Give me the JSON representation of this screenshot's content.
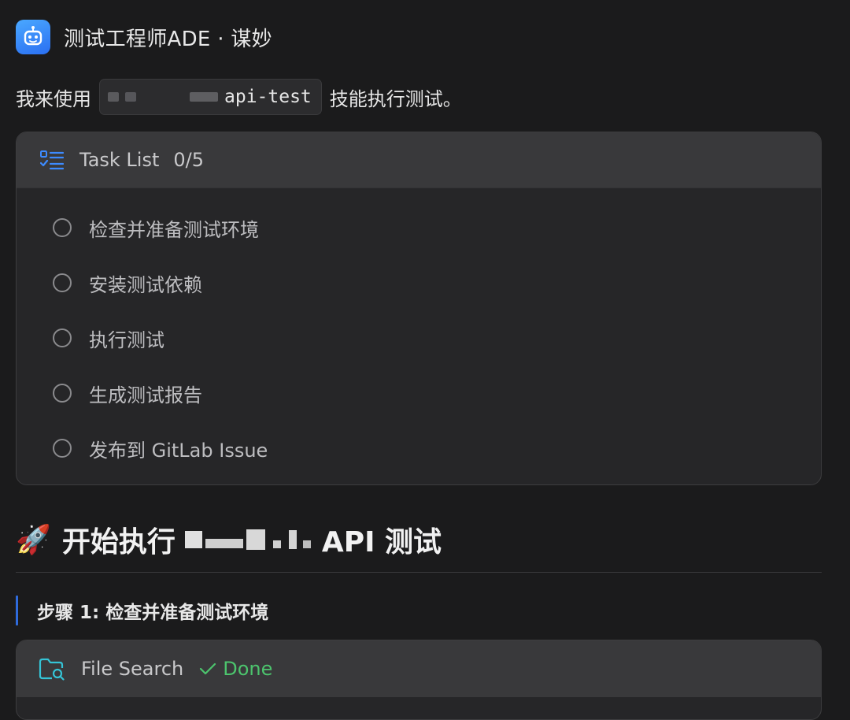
{
  "header": {
    "title": "测试工程师ADE · 谋妙"
  },
  "intro": {
    "prefix": "我来使用",
    "code": "api-test",
    "suffix": "技能执行测试。"
  },
  "task_list": {
    "title": "Task List",
    "count": "0/5",
    "items": [
      {
        "label": "检查并准备测试环境"
      },
      {
        "label": "安装测试依赖"
      },
      {
        "label": "执行测试"
      },
      {
        "label": "生成测试报告"
      },
      {
        "label": "发布到 GitLab Issue"
      }
    ]
  },
  "section": {
    "prefix": "开始执行",
    "suffix": "API 测试"
  },
  "step": {
    "label": "步骤 1: 检查并准备测试环境"
  },
  "file_search": {
    "title": "File Search",
    "status": "Done"
  },
  "colors": {
    "accent": "#2f6bdc",
    "success": "#4cc46d",
    "background": "#1b1b1c"
  }
}
